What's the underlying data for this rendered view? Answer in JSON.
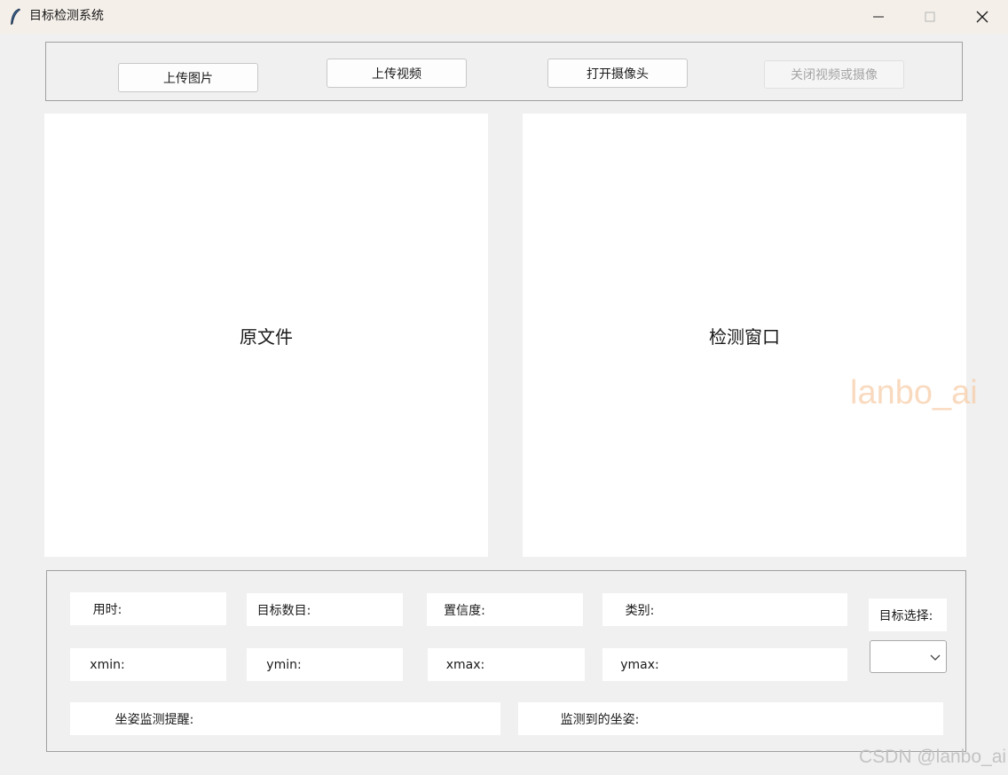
{
  "window": {
    "title": "目标检测系统",
    "icon": "feather-icon",
    "controls": [
      "minimize-icon",
      "maximize-icon",
      "close-icon"
    ]
  },
  "toolbar": {
    "upload_image": "上传图片",
    "upload_video": "上传视频",
    "open_camera": "打开摄像头",
    "close_video_camera": "关闭视频或摄像"
  },
  "panels": {
    "original": "原文件",
    "detection": "检测窗口"
  },
  "info": {
    "time_label": "用时:",
    "time_value": "",
    "count_label": "目标数目:",
    "count_value": "",
    "confidence_label": "置信度:",
    "confidence_value": "",
    "class_label": "类别:",
    "class_value": "",
    "target_select_label": "目标选择:",
    "target_select_value": "",
    "xmin_label": "xmin:",
    "xmin_value": "",
    "ymin_label": "ymin:",
    "ymin_value": "",
    "xmax_label": "xmax:",
    "xmax_value": "",
    "ymax_label": "ymax:",
    "ymax_value": "",
    "posture_alert_label": "坐姿监测提醒:",
    "posture_alert_value": "",
    "posture_detected_label": "监测到的坐姿:",
    "posture_detected_value": ""
  },
  "watermarks": {
    "overlay": "lanbo_ai",
    "corner": "CSDN @lanbo_ai"
  },
  "colors": {
    "background": "#f0f0f0",
    "titlebar": "#f4efe9",
    "panel": "#ffffff",
    "border": "#a0a0a0",
    "disabled_text": "#a4a4a4",
    "watermark_orange": "#f7cdaa"
  }
}
